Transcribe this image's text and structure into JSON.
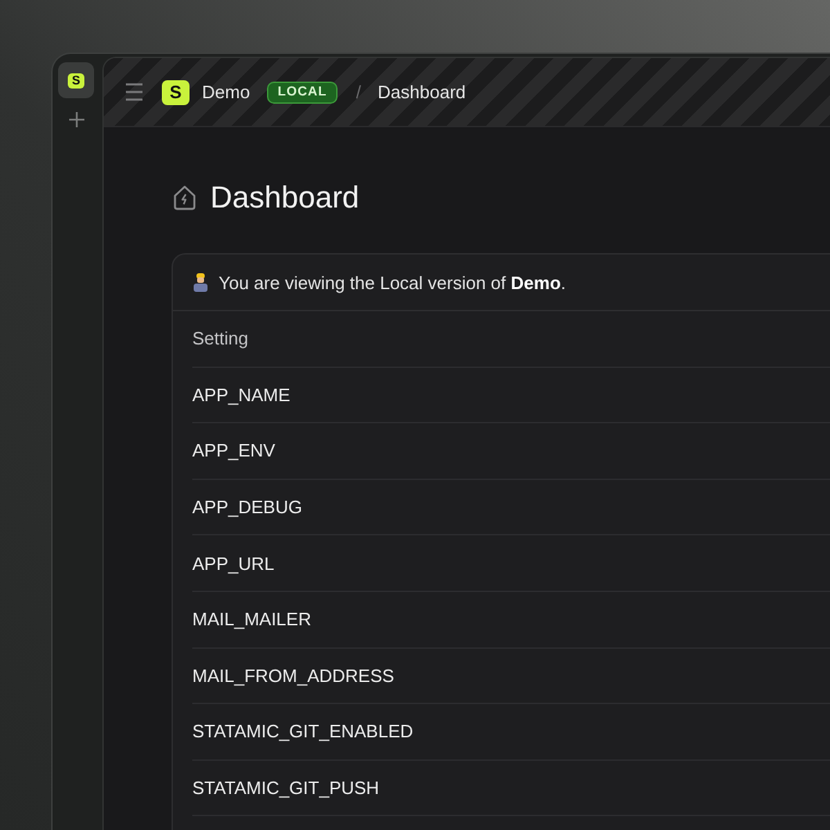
{
  "rail": {
    "logo_letter": "S"
  },
  "header": {
    "logo_letter": "S",
    "app_name": "Demo",
    "environment_badge": "LOCAL",
    "separator": "/",
    "page": "Dashboard"
  },
  "page": {
    "title": "Dashboard"
  },
  "notice": {
    "text": "You are viewing the Local version of **Demo**."
  },
  "table": {
    "columns": [
      "Setting"
    ],
    "rows": [
      [
        "APP_NAME"
      ],
      [
        "APP_ENV"
      ],
      [
        "APP_DEBUG"
      ],
      [
        "APP_URL"
      ],
      [
        "MAIL_MAILER"
      ],
      [
        "MAIL_FROM_ADDRESS"
      ],
      [
        "STATAMIC_GIT_ENABLED"
      ],
      [
        "STATAMIC_GIT_PUSH"
      ]
    ]
  }
}
